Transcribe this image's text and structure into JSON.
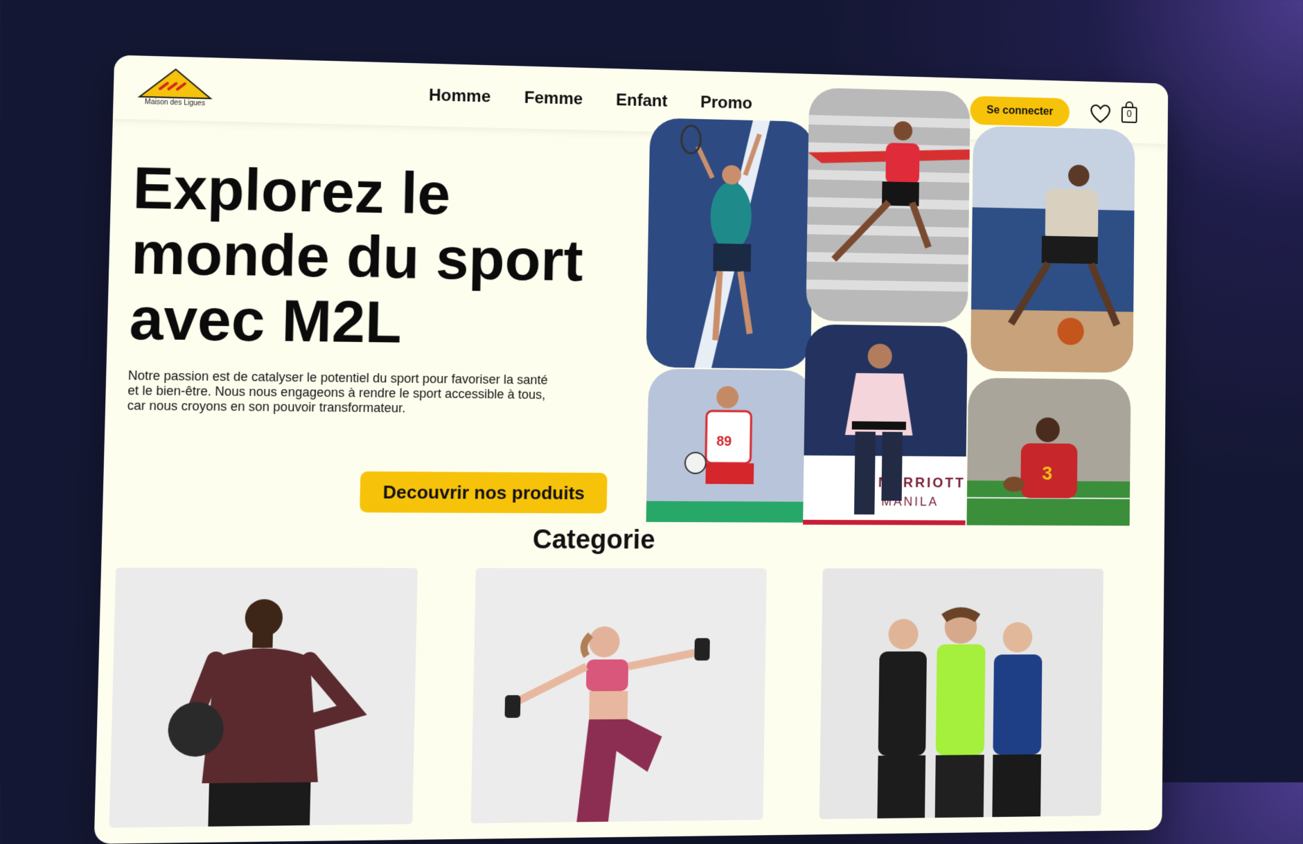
{
  "brand": {
    "logo_text": "Maison des Ligues"
  },
  "nav": {
    "items": [
      "Homme",
      "Femme",
      "Enfant",
      "Promo"
    ]
  },
  "header": {
    "login_label": "Se connecter",
    "cart_count": "0"
  },
  "hero": {
    "title_line1": "Explorez le",
    "title_line2": "monde du sport",
    "title_line3": "avec M2L",
    "description": "Notre passion est de catalyser le potentiel du sport pour favoriser la santé et le bien-être. Nous nous engageons à rendre le sport accessible à tous, car nous croyons en son pouvoir transformateur.",
    "cta_label": "Decouvrir nos produits"
  },
  "photos": {
    "banner_line1": "MARRIOTT",
    "banner_line2": "MANILA",
    "handball_number": "89",
    "football_number": "3"
  },
  "categories": {
    "title": "Categorie"
  },
  "colors": {
    "accent": "#f7c30a",
    "page_bg": "#fefeef",
    "frame_bg": "#141733"
  },
  "icons": [
    "heart-icon",
    "shopping-bag-icon",
    "logo-triangle-icon"
  ]
}
